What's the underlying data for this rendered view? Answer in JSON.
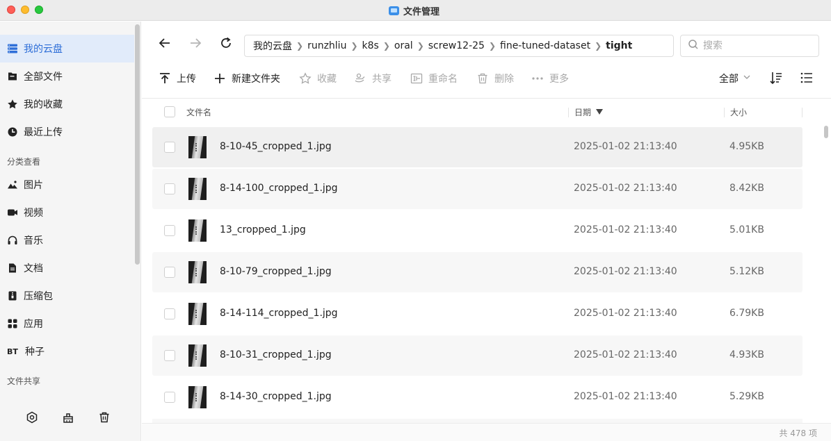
{
  "window": {
    "title": "文件管理",
    "colors": {
      "close": "#fe5f57",
      "minimize": "#febc2e",
      "maximize": "#28c840",
      "accent": "#2f6fd8"
    }
  },
  "sidebar": {
    "items_top": [
      {
        "label": "我的云盘",
        "icon": "cloud-drive-icon",
        "active": true
      },
      {
        "label": "全部文件",
        "icon": "folder-icon"
      },
      {
        "label": "我的收藏",
        "icon": "star-icon"
      },
      {
        "label": "最近上传",
        "icon": "clock-icon"
      }
    ],
    "section_category": "分类查看",
    "items_category": [
      {
        "label": "图片",
        "icon": "image-icon"
      },
      {
        "label": "视频",
        "icon": "video-icon"
      },
      {
        "label": "音乐",
        "icon": "headphones-icon"
      },
      {
        "label": "文档",
        "icon": "document-icon"
      },
      {
        "label": "压缩包",
        "icon": "archive-icon"
      },
      {
        "label": "应用",
        "icon": "apps-icon"
      },
      {
        "label": "种子",
        "icon": "bt-icon",
        "icon_text": "BT"
      }
    ],
    "section_share": "文件共享",
    "bottom_icons": [
      "settings-icon",
      "cleanup-icon",
      "trash-icon"
    ]
  },
  "nav": {
    "breadcrumb": [
      "我的云盘",
      "runzhliu",
      "k8s",
      "oral",
      "screw12-25",
      "fine-tuned-dataset",
      "tight"
    ],
    "search_placeholder": "搜索"
  },
  "toolbar": {
    "upload": "上传",
    "new_folder": "新建文件夹",
    "favorite": "收藏",
    "share": "共享",
    "rename": "重命名",
    "delete": "删除",
    "more": "更多",
    "filter": "全部"
  },
  "table": {
    "columns": {
      "name": "文件名",
      "date": "日期",
      "size": "大小"
    },
    "rows": [
      {
        "name": "8-10-45_cropped_1.jpg",
        "date": "2025-01-02 21:13:40",
        "size": "4.95KB"
      },
      {
        "name": "8-14-100_cropped_1.jpg",
        "date": "2025-01-02 21:13:40",
        "size": "8.42KB"
      },
      {
        "name": "13_cropped_1.jpg",
        "date": "2025-01-02 21:13:40",
        "size": "5.01KB"
      },
      {
        "name": "8-10-79_cropped_1.jpg",
        "date": "2025-01-02 21:13:40",
        "size": "5.12KB"
      },
      {
        "name": "8-14-114_cropped_1.jpg",
        "date": "2025-01-02 21:13:40",
        "size": "6.79KB"
      },
      {
        "name": "8-10-31_cropped_1.jpg",
        "date": "2025-01-02 21:13:40",
        "size": "4.93KB"
      },
      {
        "name": "8-14-30_cropped_1.jpg",
        "date": "2025-01-02 21:13:40",
        "size": "5.29KB"
      }
    ],
    "total": "共 478 项"
  }
}
